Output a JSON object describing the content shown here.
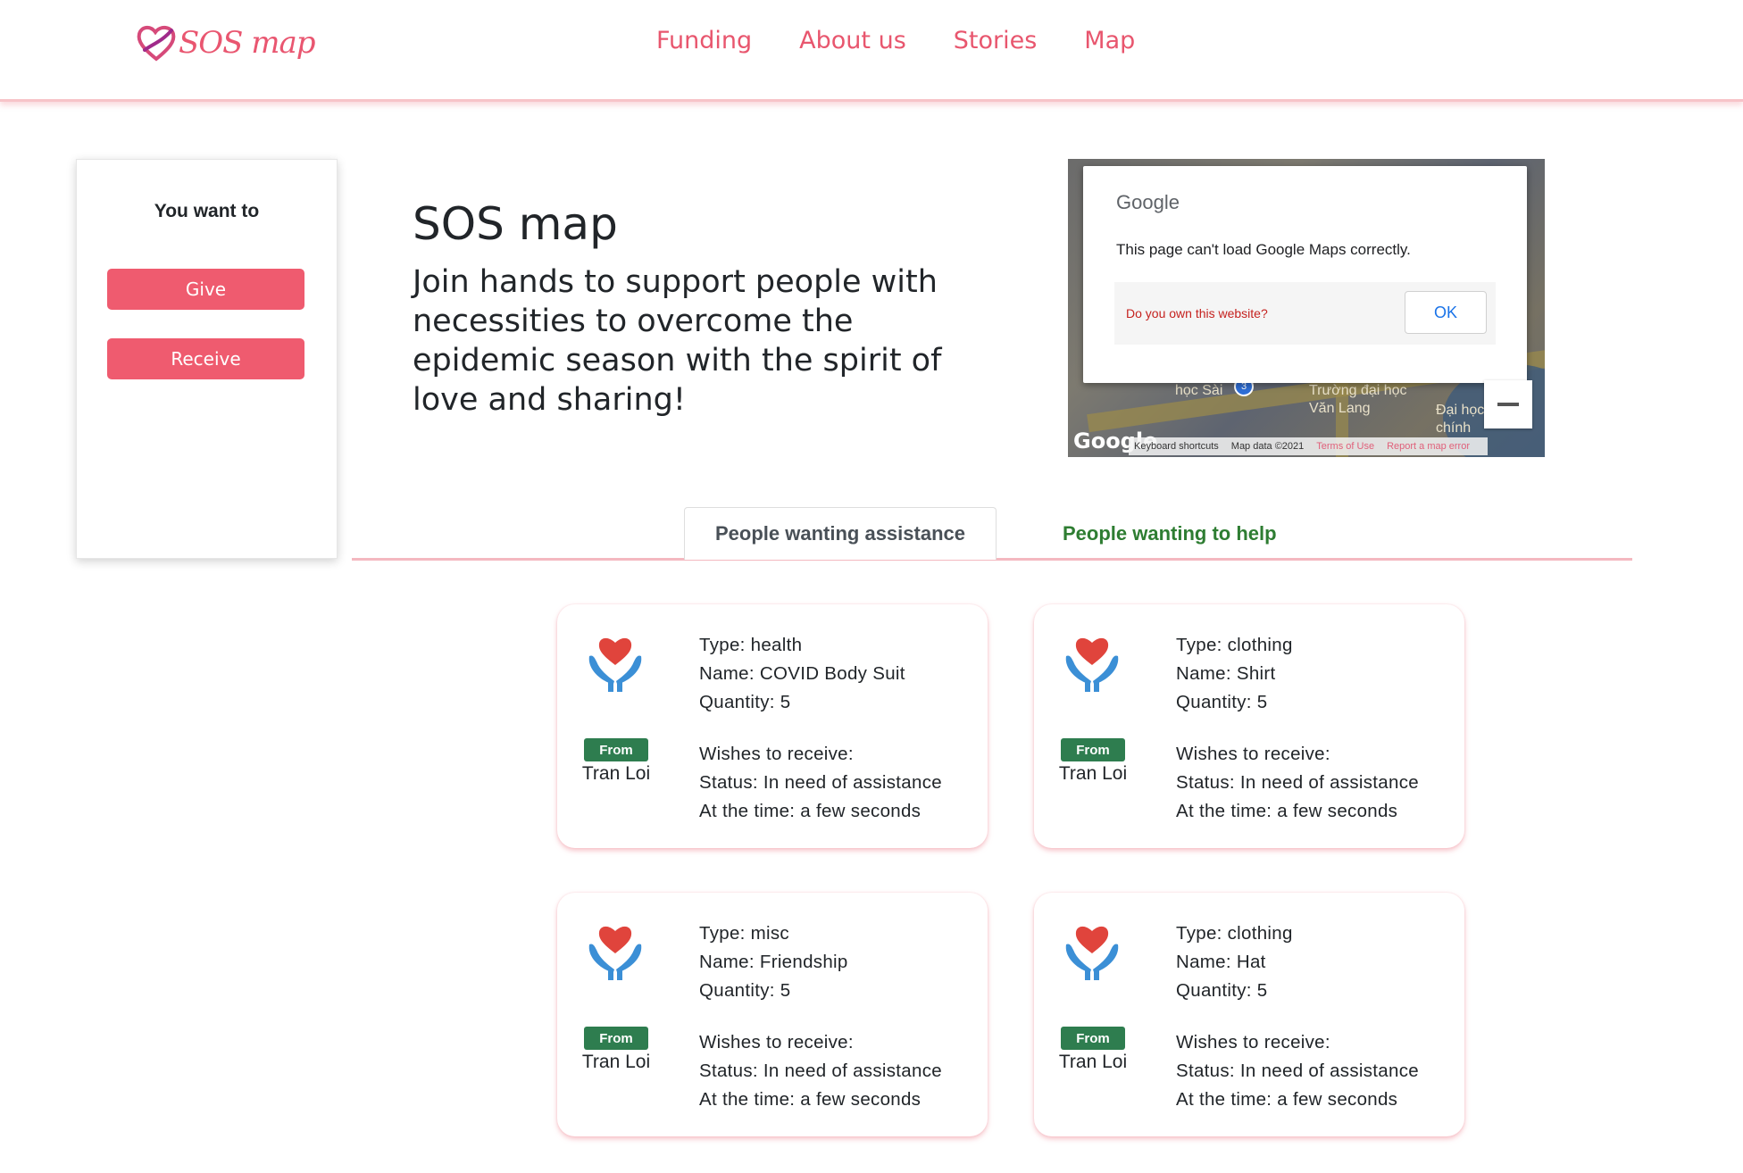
{
  "brand": {
    "name": "SOS map",
    "accent": "#e95670",
    "heart_icon": "heart-logo-icon"
  },
  "nav": [
    "Funding",
    "About us",
    "Stories",
    "Map"
  ],
  "side": {
    "title": "You want to",
    "give": "Give",
    "receive": "Receive"
  },
  "hero": {
    "title": "SOS map",
    "subtitle": "Join hands to support people with necessities to overcome the epidemic season with the spirit of love and sharing!"
  },
  "map": {
    "provider": "Google",
    "message": "This page can't load Google Maps correctly.",
    "own_link": "Do you own this website?",
    "ok": "OK",
    "labels": [
      "học Sài",
      "Trường đại học Văn Lang",
      "Đại học chính"
    ],
    "marker_count": "3",
    "watermark": "Google",
    "footer": [
      "Keyboard shortcuts",
      "Map data ©2021",
      "Terms of Use",
      "Report a map error"
    ]
  },
  "tabs": {
    "active": "People wanting assistance",
    "other": "People wanting to help"
  },
  "colors": {
    "button": "#ef5b6f",
    "badge": "#2e7d4f",
    "tab_other": "#2e7d32"
  },
  "cards": [
    {
      "type": "Type: health",
      "name": "Name: COVID Body Suit",
      "quantity": "Quantity: 5",
      "badge": "From",
      "from": "Tran Loi",
      "wishes": "Wishes to receive:",
      "status": "Status: In need of assistance",
      "time": "At the time: a few seconds"
    },
    {
      "type": "Type: clothing",
      "name": "Name: Shirt",
      "quantity": "Quantity: 5",
      "badge": "From",
      "from": "Tran Loi",
      "wishes": "Wishes to receive:",
      "status": "Status: In need of assistance",
      "time": "At the time: a few seconds"
    },
    {
      "type": "Type: misc",
      "name": "Name: Friendship",
      "quantity": "Quantity: 5",
      "badge": "From",
      "from": "Tran Loi",
      "wishes": "Wishes to receive:",
      "status": "Status: In need of assistance",
      "time": "At the time: a few seconds"
    },
    {
      "type": "Type: clothing",
      "name": "Name: Hat",
      "quantity": "Quantity: 5",
      "badge": "From",
      "from": "Tran Loi",
      "wishes": "Wishes to receive:",
      "status": "Status: In need of assistance",
      "time": "At the time: a few seconds"
    }
  ]
}
